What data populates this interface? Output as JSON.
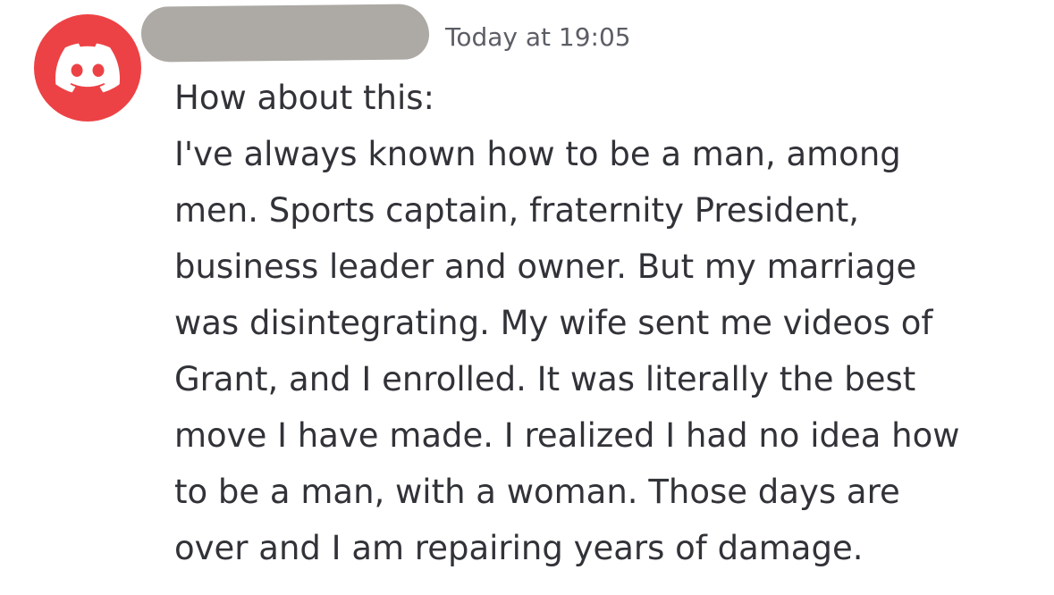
{
  "message": {
    "author": {
      "avatar_icon": "discord-logo-icon",
      "avatar_color": "#ed4245",
      "name_redacted": true
    },
    "timestamp": "Today at 19:05",
    "lines": [
      "How about this:",
      "I've always known how to be a man, among",
      "men. Sports captain, fraternity President,",
      "business leader and owner. But my marriage",
      "was disintegrating. My wife sent me videos of",
      "Grant, and I enrolled. It was literally the best",
      "move I have made. I realized I had no idea how",
      "to be a man, with a woman. Those days are",
      "over and I am repairing years of damage."
    ]
  }
}
